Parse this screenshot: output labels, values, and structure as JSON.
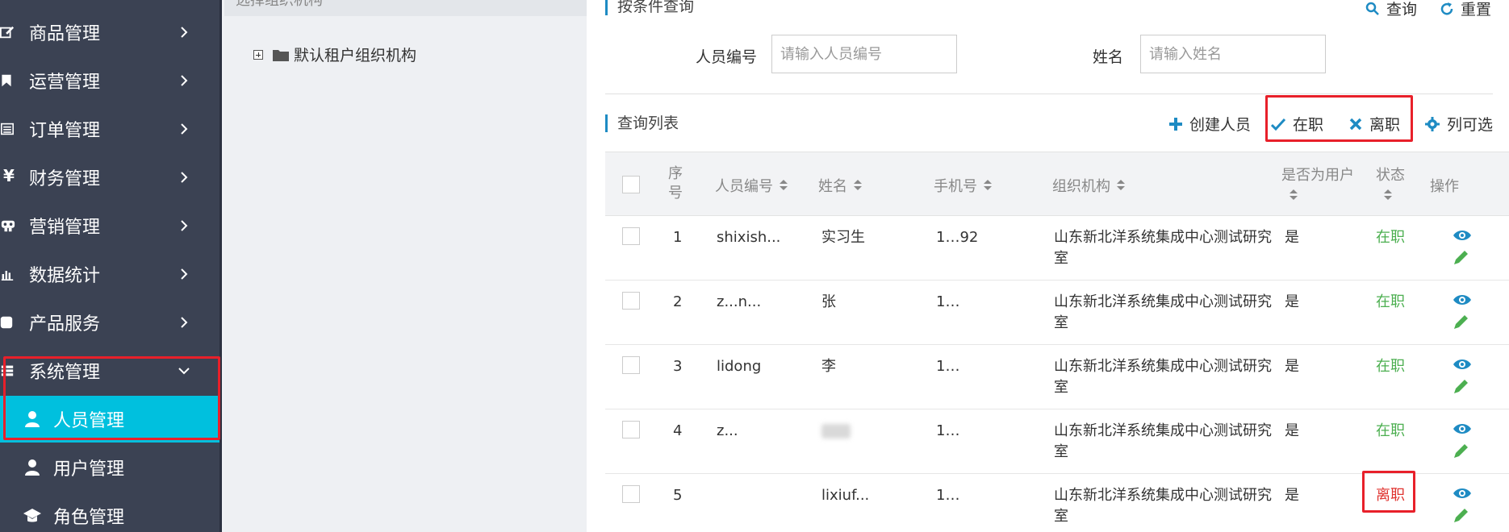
{
  "sidebar": {
    "menu": [
      {
        "icon": "edit-icon",
        "label": "商品管理"
      },
      {
        "icon": "bookmark-icon",
        "label": "运营管理"
      },
      {
        "icon": "list-icon",
        "label": "订单管理"
      },
      {
        "icon": "yen-icon",
        "label": "财务管理"
      },
      {
        "icon": "gamepad-icon",
        "label": "营销管理"
      },
      {
        "icon": "bar-chart-icon",
        "label": "数据统计"
      },
      {
        "icon": "square-icon",
        "label": "产品服务"
      },
      {
        "icon": "table-icon",
        "label": "系统管理"
      }
    ],
    "sub_items": [
      {
        "icon": "user-icon",
        "label": "人员管理"
      },
      {
        "icon": "user-icon",
        "label": "用户管理"
      },
      {
        "icon": "graduation-cap-icon",
        "label": "角色管理"
      }
    ]
  },
  "tree": {
    "header": "选择组织机构",
    "root_label": "默认租户组织机构"
  },
  "search": {
    "title": "按条件查询",
    "query_label": "查询",
    "reset_label": "重置",
    "employee_no_label": "人员编号",
    "employee_no_placeholder": "请输入人员编号",
    "name_label": "姓名",
    "name_placeholder": "请输入姓名"
  },
  "list": {
    "title": "查询列表",
    "create_label": "创建人员",
    "on_duty_label": "在职",
    "resigned_label": "离职",
    "columns_label": "列可选"
  },
  "table": {
    "headers": {
      "seq": "序号",
      "employee_no": "人员编号",
      "name": "姓名",
      "phone": "手机号",
      "org": "组织机构",
      "is_user": "是否为用户",
      "status": "状态",
      "actions": "操作"
    },
    "rows": [
      {
        "seq": "1",
        "employee_no": "shixish...",
        "name": "实习生",
        "phone": "1…92",
        "org": "山东新北洋系统集成中心测试研究室",
        "is_user": "是",
        "status": "在职",
        "status_type": "on"
      },
      {
        "seq": "2",
        "employee_no": "z...n...",
        "name": "张",
        "phone": "1…",
        "org": "山东新北洋系统集成中心测试研究室",
        "is_user": "是",
        "status": "在职",
        "status_type": "on"
      },
      {
        "seq": "3",
        "employee_no": "lidong",
        "name": "李",
        "phone": "1…",
        "org": "山东新北洋系统集成中心测试研究室",
        "is_user": "是",
        "status": "在职",
        "status_type": "on"
      },
      {
        "seq": "4",
        "employee_no": "z...",
        "name": "",
        "phone": "1…",
        "org": "山东新北洋系统集成中心测试研究室",
        "is_user": "是",
        "status": "在职",
        "status_type": "on"
      },
      {
        "seq": "5",
        "employee_no": "",
        "name": "lixiuf...",
        "phone": "1…",
        "org": "山东新北洋系统集成中心测试研究室",
        "is_user": "是",
        "status": "离职",
        "status_type": "off"
      }
    ]
  },
  "colors": {
    "sidebar_bg": "#3b4253",
    "active_bg": "#00c0de",
    "accent": "#1e8bc3",
    "status_on": "#4caf50",
    "status_off": "#e0332f",
    "highlight_box": "#e8202a"
  }
}
